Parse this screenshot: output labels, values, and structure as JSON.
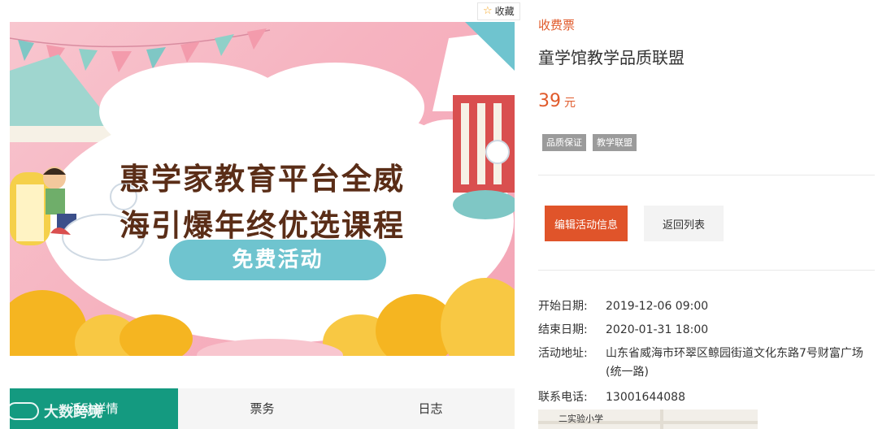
{
  "favorite": {
    "icon": "star-icon",
    "label": "收藏"
  },
  "banner": {
    "line1": "惠学家教育平台全威",
    "line2": "海引爆年终优选课程",
    "pill": "免费活动"
  },
  "event": {
    "ticket_type": "收费票",
    "title": "童学馆教学品质联盟",
    "price": "39",
    "price_unit": "元",
    "tags": [
      "品质保证",
      "教学联盟"
    ]
  },
  "actions": {
    "edit": "编辑活动信息",
    "back": "返回列表"
  },
  "details": {
    "start_label": "开始日期:",
    "start_value": "2019-12-06 09:00",
    "end_label": "结束日期:",
    "end_value": "2020-01-31 18:00",
    "address_label": "活动地址:",
    "address_value": "山东省威海市环翠区鲸园街道文化东路7号财富广场(统一路)",
    "phone_label": "联系电话:",
    "phone_value": "13001644088"
  },
  "map": {
    "label": "二实验小学"
  },
  "tabs": [
    {
      "label": "活动详情",
      "active": true
    },
    {
      "label": "票务",
      "active": false
    },
    {
      "label": "日志",
      "active": false
    }
  ],
  "watermark": {
    "text": "大数跨境"
  },
  "colors": {
    "accent": "#e0542a",
    "tab_active": "#149a80",
    "tag_bg": "#9b9b9b",
    "pill": "#6fc4cf"
  }
}
